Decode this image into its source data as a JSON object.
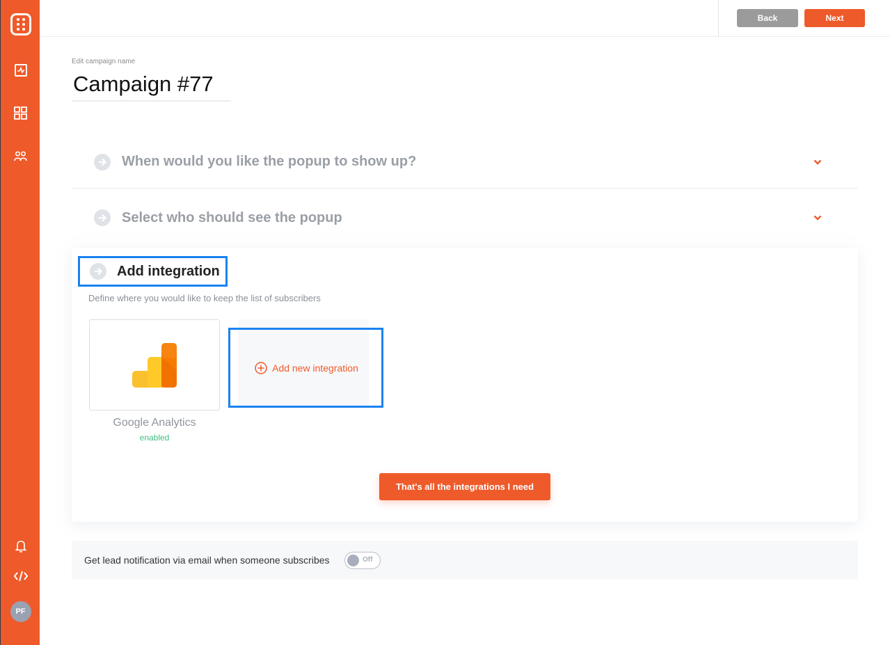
{
  "sidebar": {
    "items": [
      {
        "icon": "app-logo-icon"
      },
      {
        "icon": "activity-icon"
      },
      {
        "icon": "dashboard-grid-icon"
      },
      {
        "icon": "users-icon"
      },
      {
        "icon": "bell-icon"
      },
      {
        "icon": "code-icon"
      }
    ],
    "avatar_initials": "PF"
  },
  "topbar": {
    "back_label": "Back",
    "next_label": "Next"
  },
  "campaign": {
    "name_label": "Edit campaign name",
    "name_value": "Campaign #77"
  },
  "sections": [
    {
      "title": "When would you like the popup to show up?",
      "expanded": false
    },
    {
      "title": "Select who should see the popup",
      "expanded": false
    }
  ],
  "integration": {
    "title": "Add integration",
    "description": "Define where you would like to keep the list of subscribers",
    "items": [
      {
        "name": "Google Analytics",
        "status": "enabled"
      }
    ],
    "add_label": "Add new integration",
    "done_label": "That's all the integrations I need"
  },
  "notification": {
    "label": "Get lead notification via email when someone subscribes",
    "toggle_state": "Off"
  },
  "colors": {
    "accent": "#ee5a2a",
    "highlight": "#1a82f0",
    "status_enabled": "#3fbf7f",
    "back_button": "#9b9b9b"
  }
}
